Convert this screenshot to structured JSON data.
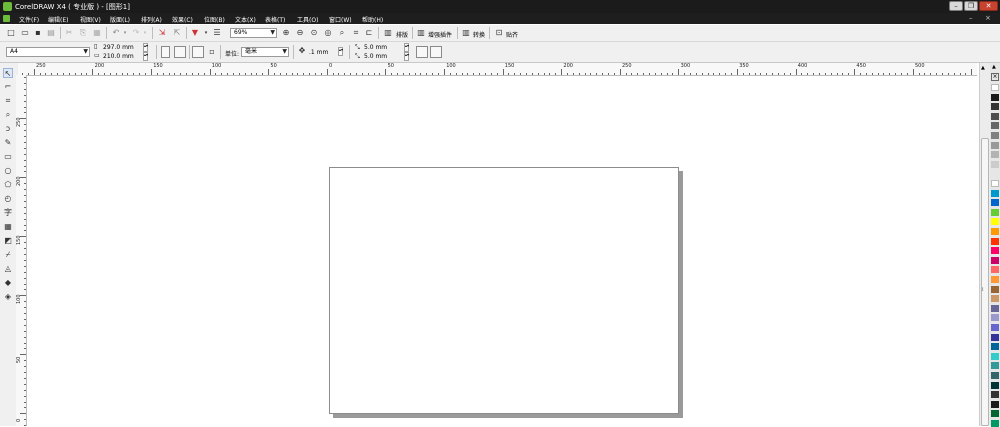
{
  "window": {
    "title": "CorelDRAW X4 ( 专业版 ) - [图形1]",
    "controls": [
      "–",
      "❐",
      "✕"
    ]
  },
  "menu": {
    "items": [
      "文件(F)",
      "编辑(E)",
      "视图(V)",
      "版面(L)",
      "排列(A)",
      "效果(C)",
      "位图(B)",
      "文本(X)",
      "表格(T)",
      "工具(O)",
      "窗口(W)",
      "帮助(H)"
    ],
    "mdi_controls": [
      "–",
      "×"
    ]
  },
  "toolbar": {
    "zoom_value": "69%",
    "buttons": [
      "排版",
      "增强插件",
      "转换",
      "贴齐"
    ]
  },
  "propertybar": {
    "paper_size": "A4",
    "width": "297.0 mm",
    "height": "210.0 mm",
    "units_label": "单位:",
    "units_value": "毫米",
    "nudge": ".1 mm",
    "dup_x": "5.0 mm",
    "dup_y": "5.0 mm"
  },
  "rulers": {
    "horizontal_labels": [
      "250",
      "200",
      "150",
      "100",
      "50",
      "0",
      "50",
      "100",
      "150",
      "200",
      "250",
      "300",
      "350",
      "400",
      "450",
      "500"
    ],
    "vertical_labels": [
      "250",
      "200",
      "150",
      "100",
      "50",
      "0"
    ],
    "unit_symbol": "毫米"
  },
  "palette": {
    "colors": [
      "#ffffff",
      "#1a1a1a",
      "#333333",
      "#4d4d4d",
      "#666666",
      "#808080",
      "#999999",
      "#b3b3b3",
      "#cccccc",
      "#e6e6e6",
      "#ffffff",
      "#0099cc",
      "#0066cc",
      "#66cc33",
      "#ffff00",
      "#ff9900",
      "#ff3300",
      "#ff0066",
      "#cc0066",
      "#ff6666",
      "#ff9933",
      "#996633",
      "#cc9966",
      "#666699",
      "#9999cc",
      "#6666cc",
      "#333399",
      "#006699",
      "#33cccc",
      "#339999",
      "#336666",
      "#003333",
      "#333333",
      "#1a1a1a",
      "#006633",
      "#009966"
    ]
  }
}
